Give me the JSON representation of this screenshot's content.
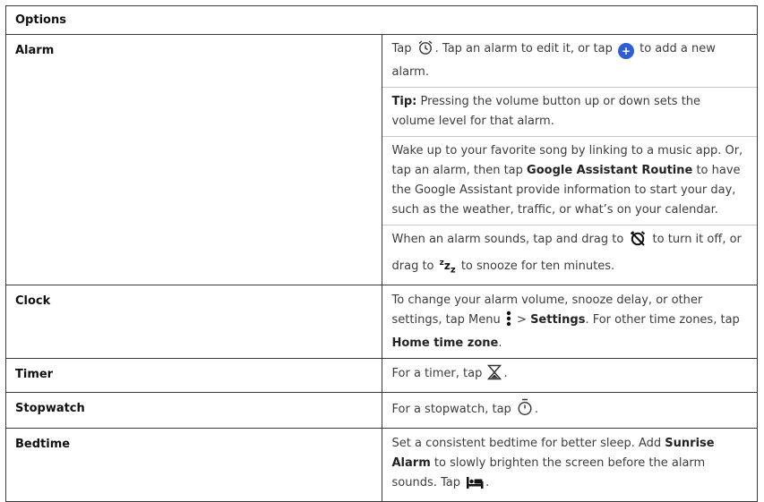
{
  "header": "Options",
  "rows": {
    "alarm": {
      "label": "Alarm",
      "p1a": "Tap ",
      "p1b": ". Tap an alarm to edit it, or tap ",
      "p1c": " to add a new alarm.",
      "tip_label": "Tip:",
      "tip_text": " Pressing the volume button up or down sets the volume level for that alarm.",
      "p3a": "Wake up to your favorite song by linking to a music app. Or, tap an alarm, then tap ",
      "p3b": "Google Assistant Routine",
      "p3c": " to have the Google Assistant provide information to start your day, such as the weather, traffic, or what’s on your calendar.",
      "p4a": "When an alarm sounds, tap and drag to ",
      "p4b": " to turn it off, or drag to ",
      "p4c": " to snooze for ten minutes."
    },
    "clock": {
      "label": "Clock",
      "a": "To change your alarm volume, snooze delay, or other settings, tap Menu ",
      "b": " > ",
      "c": "Settings",
      "d": ". For other time zones, tap ",
      "e": "Home time zone",
      "f": "."
    },
    "timer": {
      "label": "Timer",
      "a": "For a timer, tap ",
      "b": "."
    },
    "stopwatch": {
      "label": "Stopwatch",
      "a": "For a stopwatch, tap ",
      "b": "."
    },
    "bedtime": {
      "label": "Bedtime",
      "a": "Set a consistent bedtime for better sleep. Add ",
      "b": "Sunrise Alarm",
      "c": " to slowly brighten the screen before the alarm sounds. Tap ",
      "d": "."
    }
  },
  "icons": {
    "alarm": "alarm-clock-icon",
    "add": "add-icon",
    "alarm_off": "alarm-off-icon",
    "snooze": "snooze-icon",
    "menu": "menu-dots-icon",
    "timer": "hourglass-icon",
    "stopwatch": "stopwatch-icon",
    "bedtime": "bed-icon"
  },
  "colors": {
    "accent": "#2f5fd0",
    "border": "#3a3a3a",
    "text": "#3c3c3c"
  }
}
